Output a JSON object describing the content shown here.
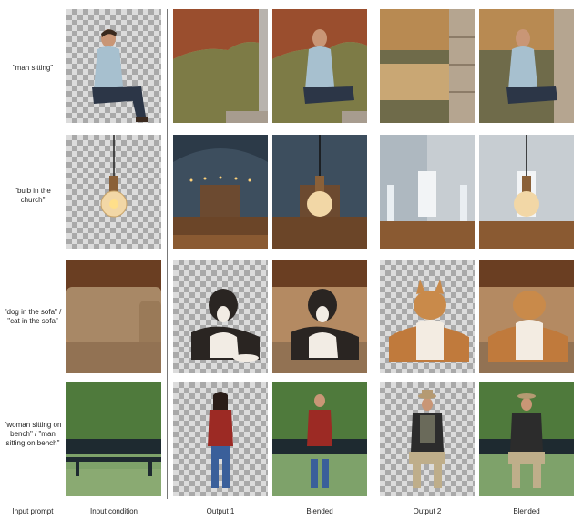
{
  "rows": [
    {
      "prompt": "\"man sitting\""
    },
    {
      "prompt": "\"bulb in the church\""
    },
    {
      "prompt": "\"dog in the sofa\" / \"cat in the sofa\""
    },
    {
      "prompt": "\"woman sitting on bench\" / \"man sitting on bench\""
    }
  ],
  "columns": [
    "Input prompt",
    "Input condition",
    "Output 1",
    "Blended",
    "Output 2",
    "Blended"
  ],
  "colors": {
    "checker_light": "#dcdcdc",
    "checker_dark": "#a9a9a9",
    "divider": "#777777"
  }
}
